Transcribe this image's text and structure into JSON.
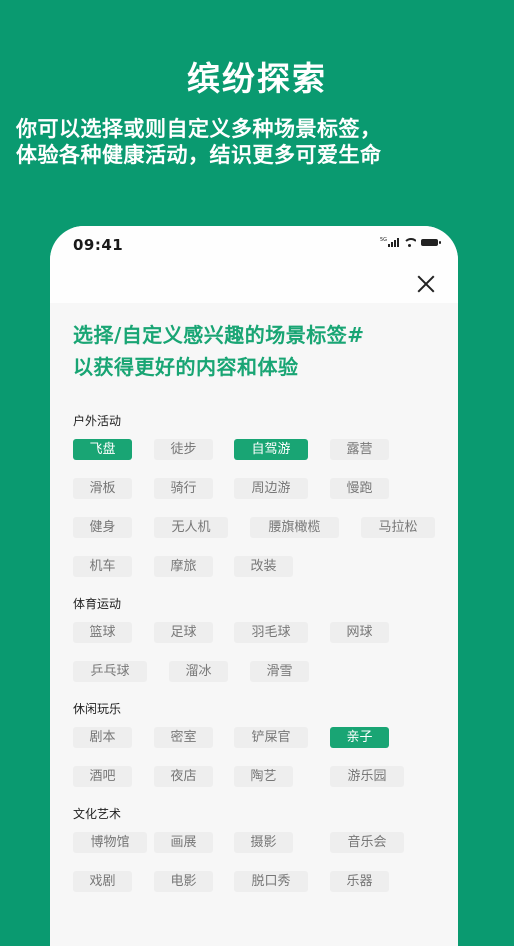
{
  "hero": {
    "title": "缤纷探索",
    "subtitle_line1": "你可以选择或则自定义多种场景标签，",
    "subtitle_line2": "体验各种健康活动，结识更多可爱生命"
  },
  "colors": {
    "background": "#0a9a70",
    "accent": "#19a574",
    "chip_bg": "#eeeeee",
    "chip_text": "#777777"
  },
  "status_bar": {
    "time": "09:41",
    "network": "5G",
    "icons": [
      "signal-icon",
      "wifi-icon",
      "battery-icon"
    ]
  },
  "nav": {
    "close_icon": "close-icon"
  },
  "headline": {
    "line1": "选择/自定义感兴趣的场景标签#",
    "line2": "以获得更好的内容和体验"
  },
  "sections": [
    {
      "title": "户外活动",
      "rows": [
        [
          {
            "label": "飞盘",
            "selected": true
          },
          {
            "label": "徒步",
            "selected": false
          },
          {
            "label": "自驾游",
            "selected": true
          },
          {
            "label": "露营",
            "selected": false
          }
        ],
        [
          {
            "label": "滑板",
            "selected": false
          },
          {
            "label": "骑行",
            "selected": false
          },
          {
            "label": "周边游",
            "selected": false
          },
          {
            "label": "慢跑",
            "selected": false
          }
        ],
        [
          {
            "label": "健身",
            "selected": false
          },
          {
            "label": "无人机",
            "selected": false
          },
          {
            "label": "腰旗橄榄",
            "selected": false
          },
          {
            "label": "马拉松",
            "selected": false
          }
        ],
        [
          {
            "label": "机车",
            "selected": false
          },
          {
            "label": "摩旅",
            "selected": false
          },
          {
            "label": "改装",
            "selected": false
          }
        ]
      ]
    },
    {
      "title": "体育运动",
      "rows": [
        [
          {
            "label": "篮球",
            "selected": false
          },
          {
            "label": "足球",
            "selected": false
          },
          {
            "label": "羽毛球",
            "selected": false
          },
          {
            "label": "网球",
            "selected": false
          }
        ],
        [
          {
            "label": "乒乓球",
            "selected": false
          },
          {
            "label": "溜冰",
            "selected": false
          },
          {
            "label": "滑雪",
            "selected": false
          }
        ]
      ]
    },
    {
      "title": "休闲玩乐",
      "rows": [
        [
          {
            "label": "剧本",
            "selected": false
          },
          {
            "label": "密室",
            "selected": false
          },
          {
            "label": "铲屎官",
            "selected": false
          },
          {
            "label": "亲子",
            "selected": true
          }
        ],
        [
          {
            "label": "酒吧",
            "selected": false
          },
          {
            "label": "夜店",
            "selected": false
          },
          {
            "label": "陶艺",
            "selected": false
          },
          {
            "label": "游乐园",
            "selected": false
          }
        ]
      ]
    },
    {
      "title": "文化艺术",
      "rows": [
        [
          {
            "label": "博物馆",
            "selected": false
          },
          {
            "label": "画展",
            "selected": false
          },
          {
            "label": "摄影",
            "selected": false
          },
          {
            "label": "音乐会",
            "selected": false
          }
        ],
        [
          {
            "label": "戏剧",
            "selected": false
          },
          {
            "label": "电影",
            "selected": false
          },
          {
            "label": "脱口秀",
            "selected": false
          },
          {
            "label": "乐器",
            "selected": false
          }
        ]
      ]
    }
  ]
}
